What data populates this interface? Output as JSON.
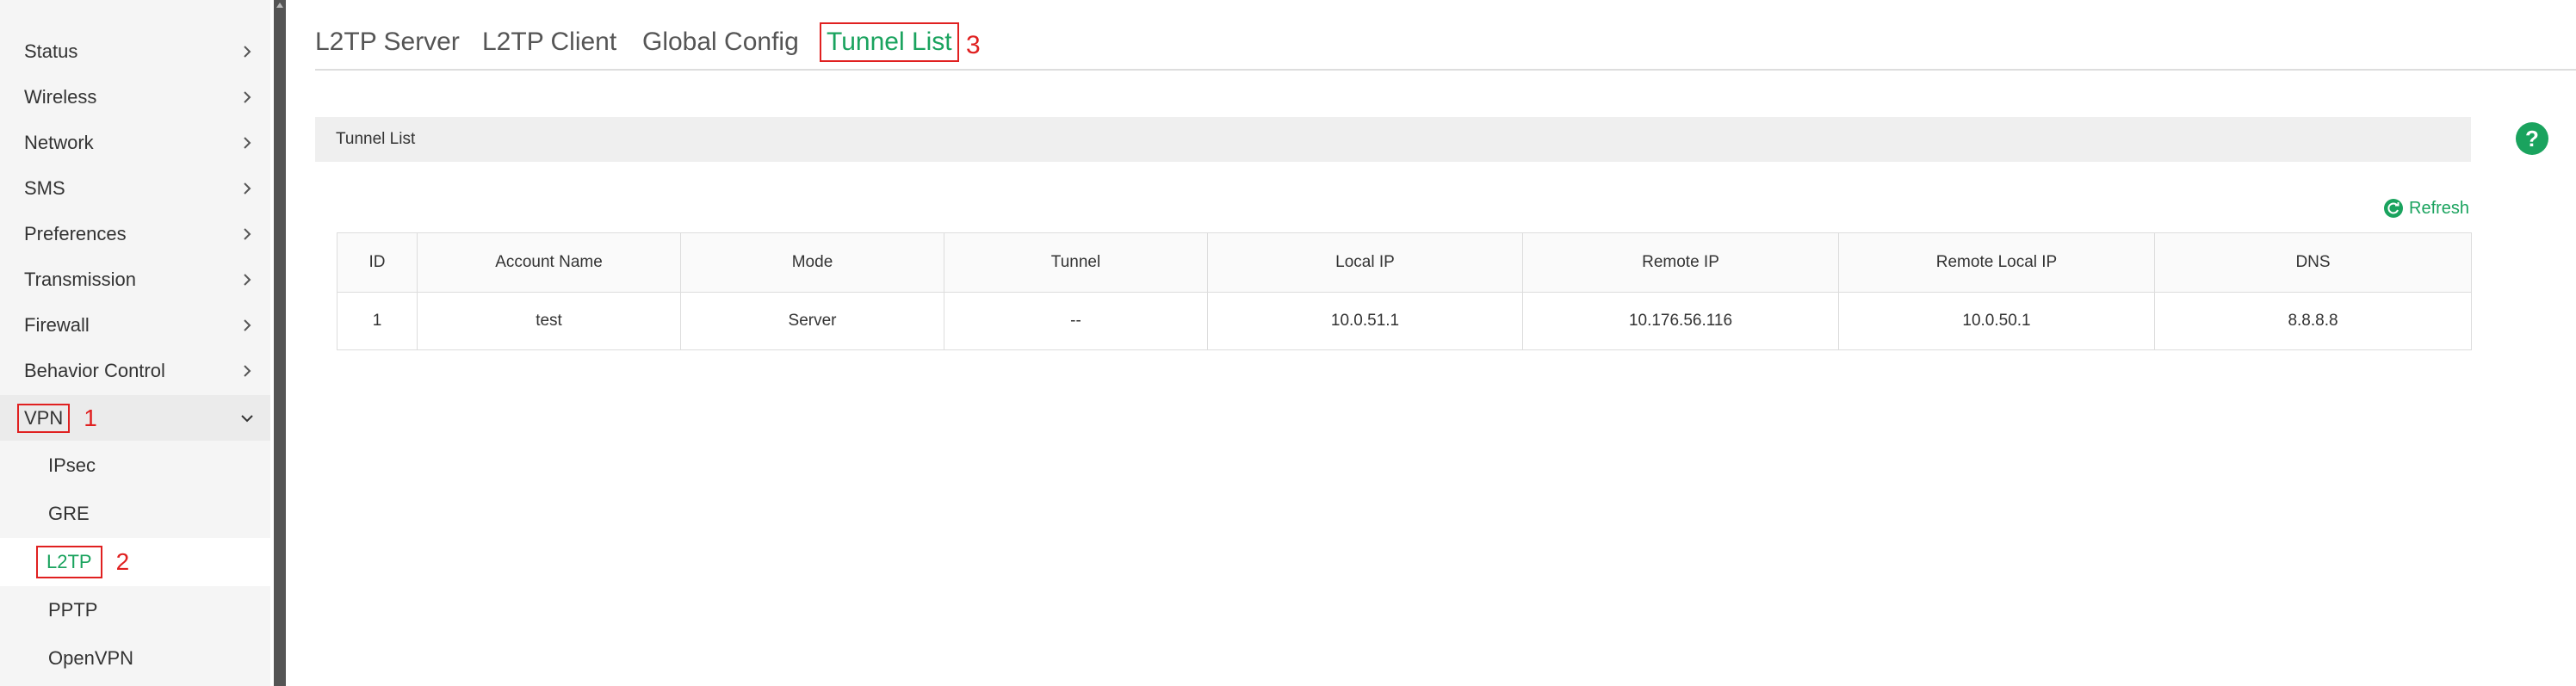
{
  "sidebar": {
    "items": [
      {
        "label": "Status"
      },
      {
        "label": "Wireless"
      },
      {
        "label": "Network"
      },
      {
        "label": "SMS"
      },
      {
        "label": "Preferences"
      },
      {
        "label": "Transmission"
      },
      {
        "label": "Firewall"
      },
      {
        "label": "Behavior Control"
      },
      {
        "label": "VPN",
        "annotation": "1"
      }
    ],
    "vpn_sub_items": [
      {
        "label": "IPsec"
      },
      {
        "label": "GRE"
      },
      {
        "label": "L2TP",
        "annotation": "2"
      },
      {
        "label": "PPTP"
      },
      {
        "label": "OpenVPN"
      }
    ]
  },
  "tabs": [
    {
      "label": "L2TP Server"
    },
    {
      "label": "L2TP Client"
    },
    {
      "label": "Global Config"
    },
    {
      "label": "Tunnel List",
      "annotation": "3"
    }
  ],
  "section": {
    "title": "Tunnel List"
  },
  "refresh_label": "Refresh",
  "help_label": "?",
  "table": {
    "headers": [
      "ID",
      "Account Name",
      "Mode",
      "Tunnel",
      "Local IP",
      "Remote IP",
      "Remote Local IP",
      "DNS"
    ],
    "rows": [
      [
        "1",
        "test",
        "Server",
        "--",
        "10.0.51.1",
        "10.176.56.116",
        "10.0.50.1",
        "8.8.8.8"
      ]
    ]
  },
  "colors": {
    "accent": "#1aa35e",
    "annotation": "#e02020"
  }
}
